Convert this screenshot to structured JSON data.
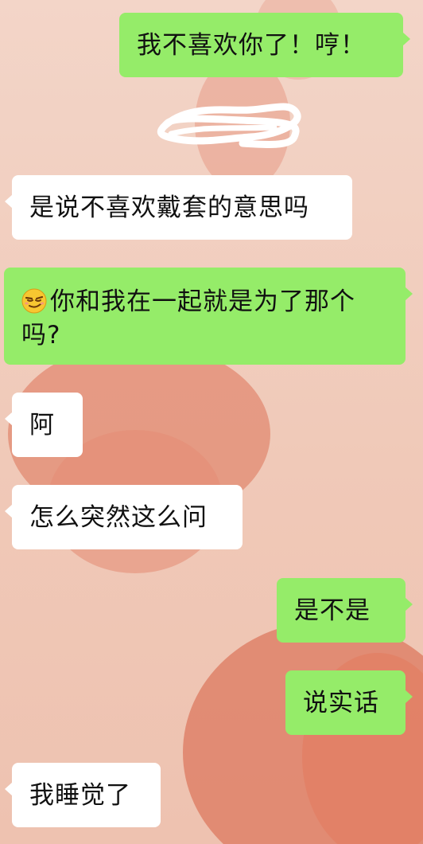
{
  "theme": {
    "outgoing_bubble": "#95ec69",
    "incoming_bubble": "#ffffff",
    "background": "#f2d2c4"
  },
  "messages": [
    {
      "side": "outgoing",
      "text": "我不喜欢你了！哼！"
    },
    {
      "side": "incoming",
      "text": "是说不喜欢戴套的意思吗"
    },
    {
      "side": "outgoing",
      "emoji": "smirk-emoji",
      "text": "你和我在一起就是为了那个吗?"
    },
    {
      "side": "incoming",
      "text": "阿"
    },
    {
      "side": "incoming",
      "text": "怎么突然这么问"
    },
    {
      "side": "outgoing",
      "text": "是不是"
    },
    {
      "side": "outgoing",
      "text": "说实话"
    },
    {
      "side": "incoming",
      "text": "我睡觉了"
    }
  ]
}
